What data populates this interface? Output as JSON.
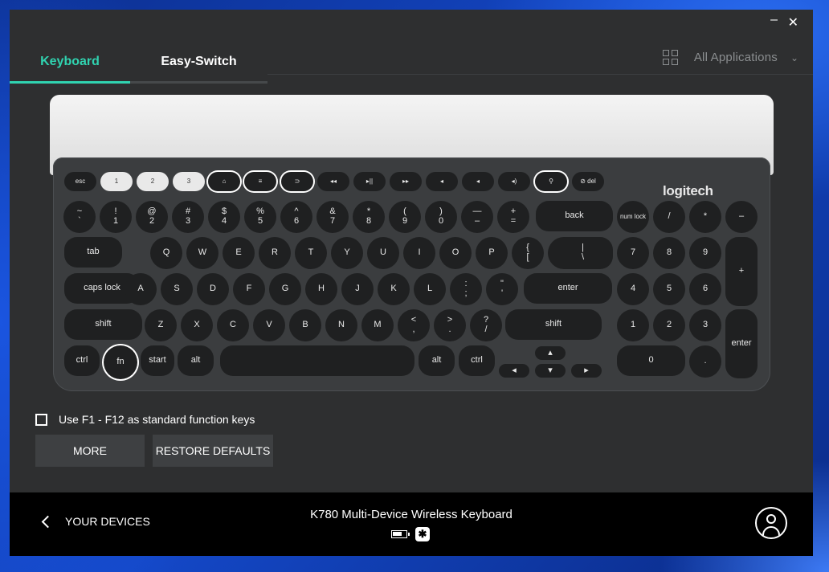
{
  "window": {
    "minimize": "–",
    "close": "✕"
  },
  "tabs": [
    {
      "label": "Keyboard"
    },
    {
      "label": "Easy-Switch"
    }
  ],
  "app_select": {
    "label": "All Applications",
    "icon": "grid-icon",
    "chevron": "⌄"
  },
  "keyboard": {
    "brand": "logitech",
    "rows": {
      "fn_row": [
        "esc",
        "1",
        "2",
        "3",
        "⌂",
        "≡",
        "⊃",
        "◂◂",
        "▸||",
        "▸▸",
        "◂",
        "◂",
        "◂)",
        "⚲",
        "⊘ del"
      ],
      "num_row": [
        "~\n`",
        "!\n1",
        "@\n2",
        "#\n3",
        "$\n4",
        "%\n5",
        "^\n6",
        "&\n7",
        "*\n8",
        "(\n9",
        ")\n0",
        "—\n–",
        "+\n=",
        "back"
      ],
      "q_row": [
        "tab",
        "Q",
        "W",
        "E",
        "R",
        "T",
        "Y",
        "U",
        "I",
        "O",
        "P",
        "{\n[",
        "}\n]",
        "|\n\\"
      ],
      "a_row": [
        "caps lock",
        "A",
        "S",
        "D",
        "F",
        "G",
        "H",
        "J",
        "K",
        "L",
        ":\n;",
        "\"\n'",
        "enter"
      ],
      "z_row": [
        "shift",
        "Z",
        "X",
        "C",
        "V",
        "B",
        "N",
        "M",
        "<\n,",
        ">\n.",
        "?\n/",
        "shift"
      ],
      "bottom_row": [
        "ctrl",
        "fn",
        "start",
        "alt",
        "",
        "alt",
        "ctrl",
        "▴",
        "◂",
        "▾",
        "▸"
      ],
      "numpad": [
        "num lock",
        "/",
        "*",
        "–",
        "7",
        "8",
        "9",
        "+",
        "4",
        "5",
        "6",
        "1",
        "2",
        "3",
        "enter",
        "0",
        "."
      ]
    }
  },
  "fn_option": {
    "label": "Use F1 - F12 as standard function keys",
    "checked": false
  },
  "buttons": {
    "more": "MORE",
    "restore": "RESTORE DEFAULTS"
  },
  "footer": {
    "back_label": "YOUR DEVICES",
    "device_name": "K780 Multi-Device Wireless Keyboard",
    "bt_glyph": "✱"
  }
}
